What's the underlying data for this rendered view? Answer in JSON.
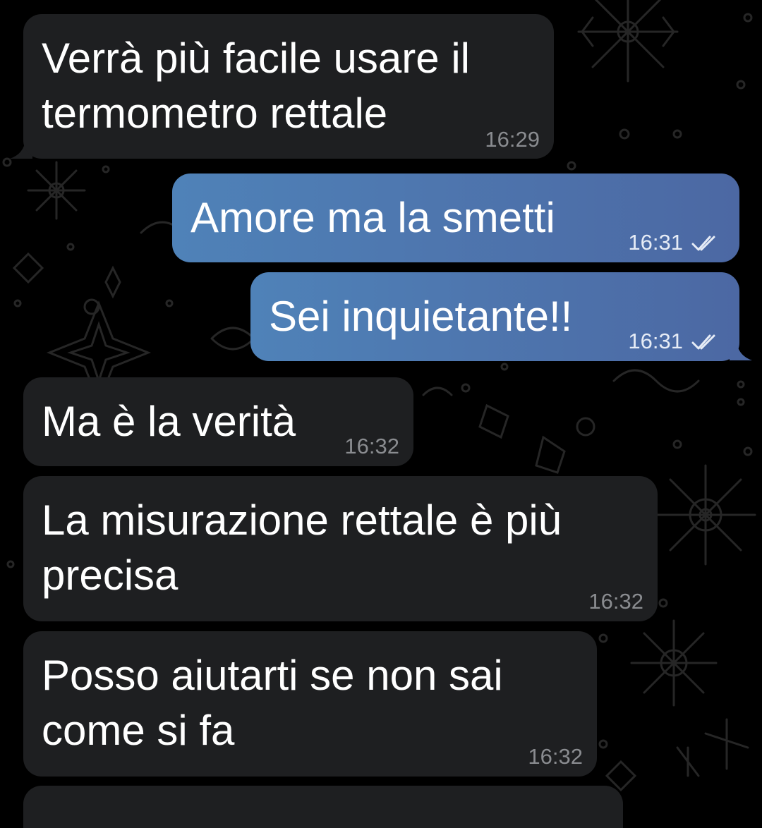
{
  "messages": [
    {
      "lines": [
        "Verrà più facile usare il",
        "termometro rettale"
      ],
      "time": "16:29"
    },
    {
      "lines": [
        "Amore ma la smetti"
      ],
      "time": "16:31",
      "status": "read-double-check-icon"
    },
    {
      "lines": [
        "Sei inquietante!!"
      ],
      "time": "16:31",
      "status": "read-double-check-icon"
    },
    {
      "lines": [
        "Ma è la verità"
      ],
      "time": "16:32"
    },
    {
      "lines": [
        "La misurazione rettale è più",
        "precisa"
      ],
      "time": "16:32"
    },
    {
      "lines": [
        "Posso aiutarti se non sai",
        "come si fa"
      ],
      "time": "16:32"
    }
  ],
  "colors": {
    "background": "#000000",
    "incoming_bubble": "#1e1f21",
    "outgoing_bubble_start": "#4f82b8",
    "outgoing_bubble_end": "#4c68a3",
    "incoming_time": "#8a8c90",
    "outgoing_time": "#e6ecf6"
  }
}
